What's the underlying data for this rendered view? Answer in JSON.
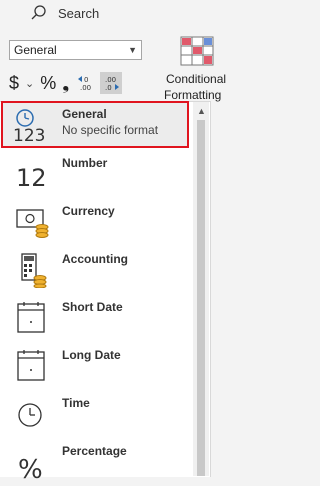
{
  "search": {
    "label": "Search"
  },
  "ribbon": {
    "format_select": "General",
    "tools": {
      "currency_symbol": "$",
      "currency_chevron": "⌄",
      "percent": "%",
      "comma": "❟"
    },
    "conditional_formatting": {
      "line1": "Conditional",
      "line2": "Formatting ⌄"
    }
  },
  "formats": [
    {
      "name": "General",
      "sub": "No specific format",
      "icon": "clock-123-icon",
      "selected": true
    },
    {
      "name": "Number",
      "icon": "number-12-icon"
    },
    {
      "name": "Currency",
      "icon": "currency-bill-icon"
    },
    {
      "name": "Accounting",
      "icon": "accounting-calculator-icon"
    },
    {
      "name": "Short Date",
      "icon": "calendar-short-icon"
    },
    {
      "name": "Long Date",
      "icon": "calendar-long-icon"
    },
    {
      "name": "Time",
      "icon": "clock-icon"
    },
    {
      "name": "Percentage",
      "icon": "percent-icon"
    }
  ],
  "colors": {
    "highlight": "#e0141e"
  }
}
